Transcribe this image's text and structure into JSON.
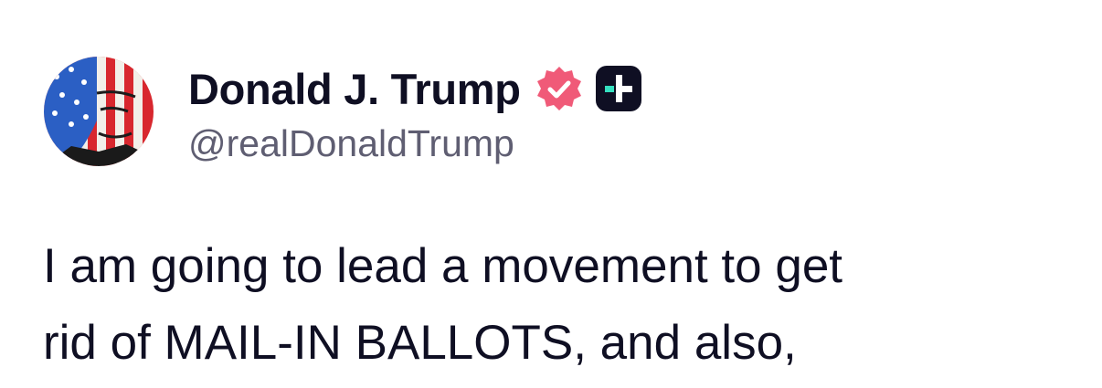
{
  "author": {
    "display_name": "Donald J. Trump",
    "handle": "@realDonaldTrump",
    "verified_badge_color": "#f05a78",
    "plus_badge_color": "#0f0f23",
    "plus_badge_accent": "#35e0c0"
  },
  "post": {
    "text": "I am going to lead a movement to get\nrid of MAIL-IN BALLOTS, and also,"
  },
  "icons": {
    "avatar": "user-avatar",
    "verified": "verified-badge-icon",
    "plus": "plus-badge-icon"
  }
}
